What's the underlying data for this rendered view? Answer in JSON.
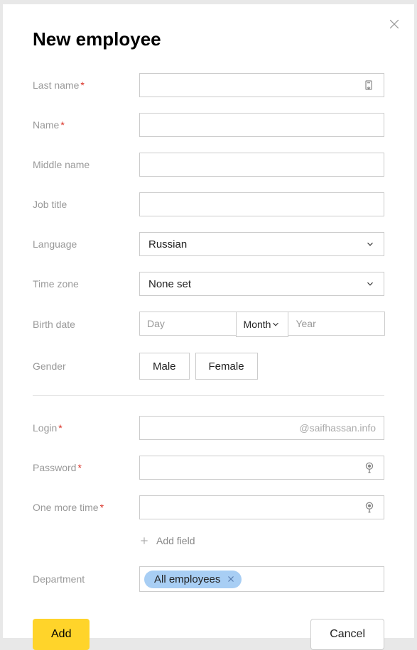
{
  "title": "New employee",
  "labels": {
    "last_name": "Last name",
    "name": "Name",
    "middle_name": "Middle name",
    "job_title": "Job title",
    "language": "Language",
    "time_zone": "Time zone",
    "birth_date": "Birth date",
    "gender": "Gender",
    "login": "Login",
    "password": "Password",
    "one_more_time": "One more time",
    "department": "Department"
  },
  "required_marker": "*",
  "values": {
    "last_name": "",
    "name": "",
    "middle_name": "",
    "job_title": "",
    "language": "Russian",
    "time_zone": "None set",
    "birth_day": "",
    "birth_month": "Month",
    "birth_year": "",
    "login": "",
    "password": "",
    "password_confirm": ""
  },
  "placeholders": {
    "birth_day": "Day",
    "birth_year": "Year"
  },
  "gender_options": {
    "male": "Male",
    "female": "Female"
  },
  "login_suffix": "@saifhassan.info",
  "add_field_label": "Add field",
  "department_chip": "All employees",
  "buttons": {
    "add": "Add",
    "cancel": "Cancel"
  }
}
